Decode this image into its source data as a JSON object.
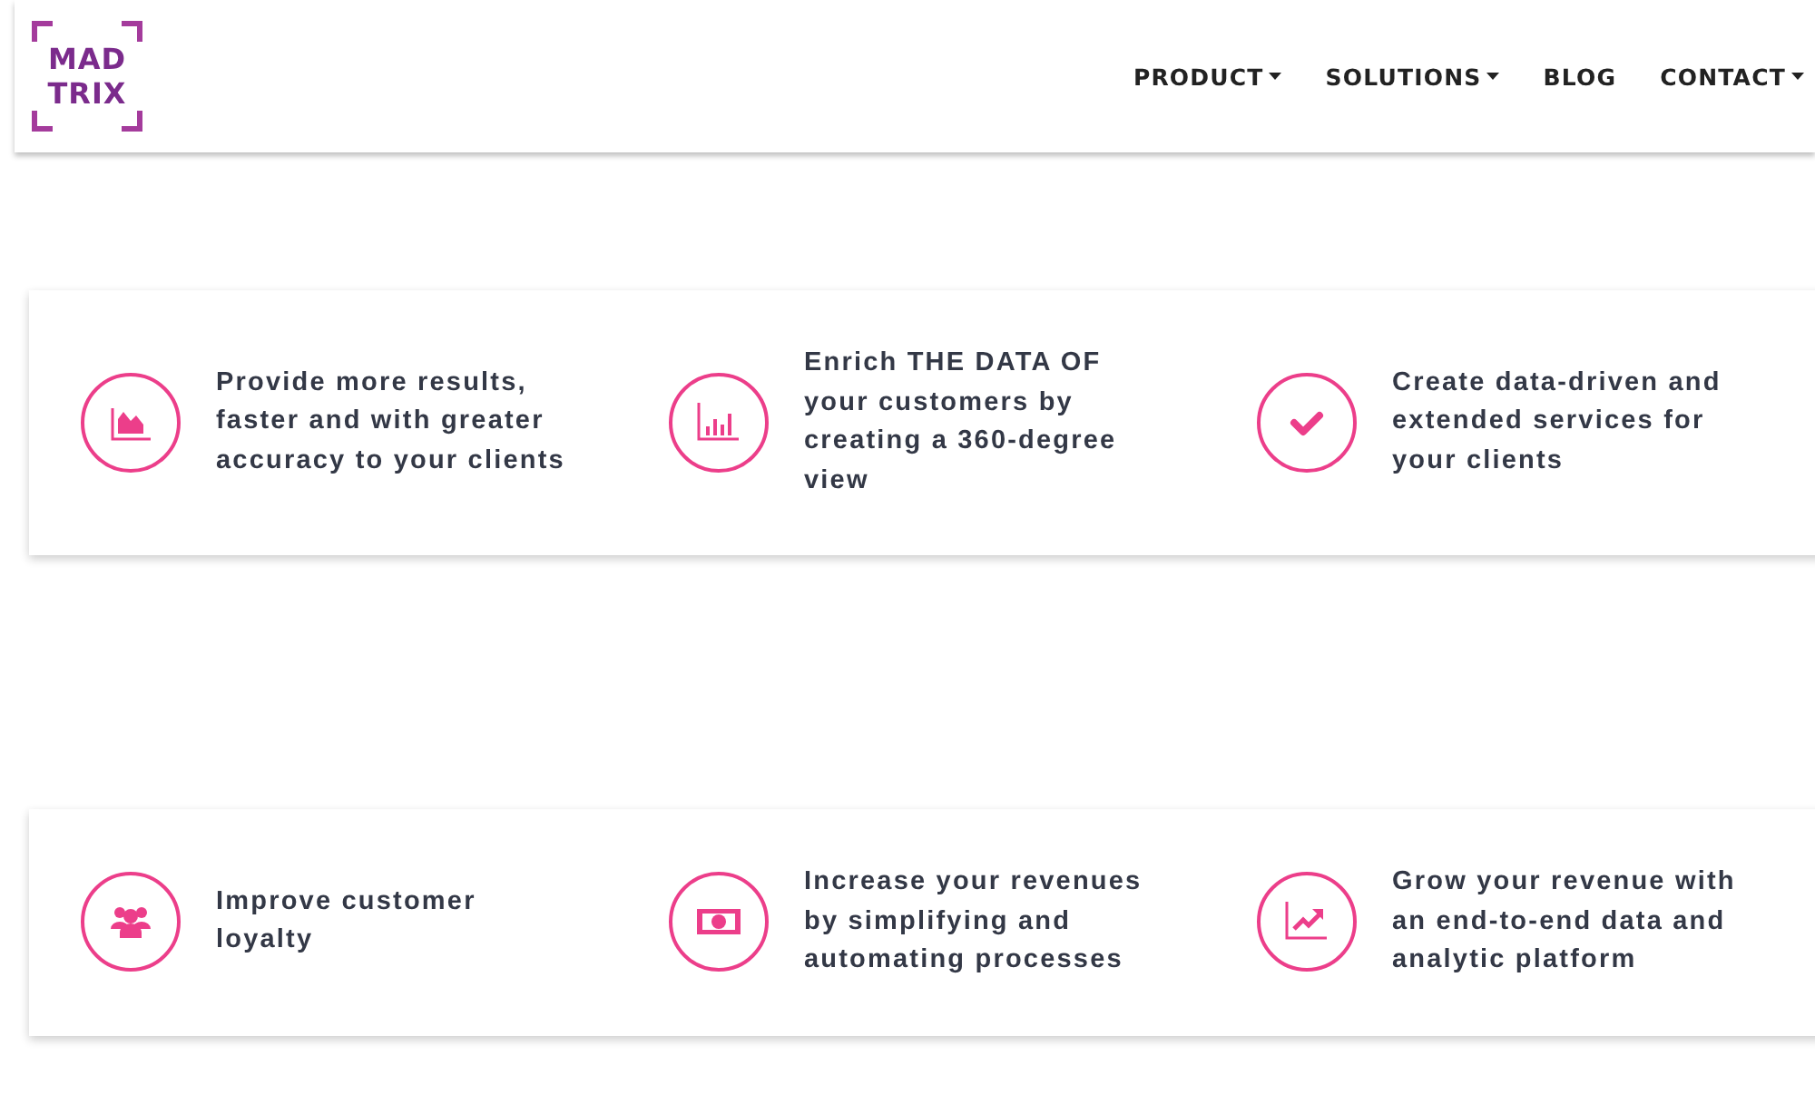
{
  "logo": {
    "lines": [
      "MAD",
      "TRIX"
    ]
  },
  "nav": [
    {
      "label": "PRODUCT",
      "dropdown": true
    },
    {
      "label": "SOLUTIONS",
      "dropdown": true
    },
    {
      "label": "BLOG",
      "dropdown": false
    },
    {
      "label": "CONTACT",
      "dropdown": true
    }
  ],
  "cards": [
    {
      "items": [
        {
          "kind": "area-chart",
          "text": "Provide more results, faster and with greater accuracy to your clients"
        },
        {
          "kind": "bar-chart",
          "text": "Enrich THE DATA OF your customers by creating a 360-degree view"
        },
        {
          "kind": "check",
          "text": "Create data-driven and extended services for your clients"
        }
      ]
    },
    {
      "items": [
        {
          "kind": "people",
          "text": "Improve customer loyalty"
        },
        {
          "kind": "money",
          "text": "Increase your revenues by simplifying and automating processes"
        },
        {
          "kind": "trend",
          "text": "Grow your revenue with an end-to-end data and analytic platform"
        }
      ]
    }
  ]
}
